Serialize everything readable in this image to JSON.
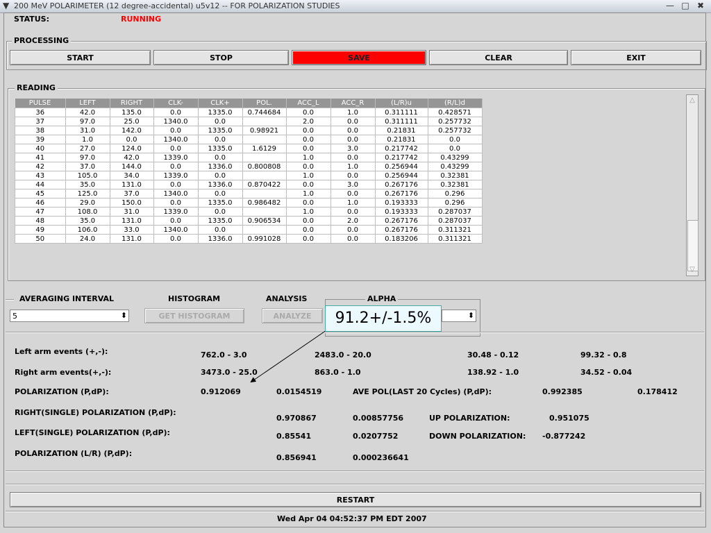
{
  "window": {
    "title": "200 MeV POLARIMETER (12 degree-accidental) u5v12 -- FOR POLARIZATION STUDIES"
  },
  "status": {
    "label": "STATUS:",
    "value": "RUNNING",
    "value_color": "#ff0000"
  },
  "processing": {
    "title": "PROCESSING",
    "buttons": [
      "START",
      "STOP",
      "SAVE",
      "CLEAR",
      "EXIT"
    ]
  },
  "reading": {
    "title": "READING",
    "headers": [
      "PULSE",
      "LEFT",
      "RIGHT",
      "CLK-",
      "CLK+",
      "POL.",
      "ACC_L",
      "ACC_R",
      "(L/R)u",
      "(R/L)d"
    ],
    "rows": [
      [
        "36",
        "42.0",
        "135.0",
        "0.0",
        "1335.0",
        "0.744684",
        "0.0",
        "1.0",
        "0.311111",
        "0.428571"
      ],
      [
        "37",
        "97.0",
        "25.0",
        "1340.0",
        "0.0",
        "",
        "2.0",
        "0.0",
        "0.311111",
        "0.257732"
      ],
      [
        "38",
        "31.0",
        "142.0",
        "0.0",
        "1335.0",
        "0.98921",
        "0.0",
        "0.0",
        "0.21831",
        "0.257732"
      ],
      [
        "39",
        "1.0",
        "0.0",
        "1340.0",
        "0.0",
        "",
        "0.0",
        "0.0",
        "0.21831",
        "0.0"
      ],
      [
        "40",
        "27.0",
        "124.0",
        "0.0",
        "1335.0",
        "1.6129",
        "0.0",
        "3.0",
        "0.217742",
        "0.0"
      ],
      [
        "41",
        "97.0",
        "42.0",
        "1339.0",
        "0.0",
        "",
        "1.0",
        "0.0",
        "0.217742",
        "0.43299"
      ],
      [
        "42",
        "37.0",
        "144.0",
        "0.0",
        "1336.0",
        "0.800808",
        "0.0",
        "1.0",
        "0.256944",
        "0.43299"
      ],
      [
        "43",
        "105.0",
        "34.0",
        "1339.0",
        "0.0",
        "",
        "1.0",
        "0.0",
        "0.256944",
        "0.32381"
      ],
      [
        "44",
        "35.0",
        "131.0",
        "0.0",
        "1336.0",
        "0.870422",
        "0.0",
        "3.0",
        "0.267176",
        "0.32381"
      ],
      [
        "45",
        "125.0",
        "37.0",
        "1340.0",
        "0.0",
        "",
        "1.0",
        "0.0",
        "0.267176",
        "0.296"
      ],
      [
        "46",
        "29.0",
        "150.0",
        "0.0",
        "1335.0",
        "0.986482",
        "0.0",
        "1.0",
        "0.193333",
        "0.296"
      ],
      [
        "47",
        "108.0",
        "31.0",
        "1339.0",
        "0.0",
        "",
        "1.0",
        "0.0",
        "0.193333",
        "0.287037"
      ],
      [
        "48",
        "35.0",
        "131.0",
        "0.0",
        "1335.0",
        "0.906534",
        "0.0",
        "2.0",
        "0.267176",
        "0.287037"
      ],
      [
        "49",
        "106.0",
        "33.0",
        "1340.0",
        "0.0",
        "",
        "0.0",
        "0.0",
        "0.267176",
        "0.311321"
      ],
      [
        "50",
        "24.0",
        "131.0",
        "0.0",
        "1336.0",
        "0.991028",
        "0.0",
        "0.0",
        "0.183206",
        "0.311321"
      ]
    ]
  },
  "controls": {
    "averaging_label": "AVERAGING INTERVAL",
    "averaging_value": "5",
    "histogram_label": "HISTOGRAM",
    "histogram_button": "GET HISTOGRAM",
    "analysis_label": "ANALYSIS",
    "analysis_button": "ANALYZE",
    "alpha_label": "ALPHA"
  },
  "callout": {
    "text": "91.2+/-1.5%"
  },
  "results": {
    "left_arm": {
      "label": "Left arm events (+,-):",
      "v1": "762.0 - 3.0",
      "v2": "2483.0 - 20.0",
      "v3": "30.48 - 0.12",
      "v4": "99.32 - 0.8"
    },
    "right_arm": {
      "label": "Right arm events(+,-):",
      "v1": "3473.0 - 25.0",
      "v2": "863.0 - 1.0",
      "v3": "138.92 - 1.0",
      "v4": "34.52 - 0.04"
    },
    "polarization": {
      "label": "POLARIZATION (P,dP):",
      "p": "0.912069",
      "dp": "0.0154519",
      "ave_label": "AVE POL(LAST 20 Cycles) (P,dP):",
      "ave_p": "0.992385",
      "ave_dp": "0.178412"
    },
    "right_single": {
      "label": "RIGHT(SINGLE) POLARIZATION (P,dP):",
      "p": "0.970867",
      "dp": "0.00857756",
      "up_label": "UP POLARIZATION:",
      "up": "0.951075"
    },
    "left_single": {
      "label": "LEFT(SINGLE) POLARIZATION (P,dP):",
      "p": "0.85541",
      "dp": "0.0207752",
      "down_label": "DOWN POLARIZATION:",
      "down": "-0.877242"
    },
    "polarization_lr": {
      "label": "POLARIZATION (L/R) (P,dP):",
      "p": "0.856941",
      "dp": "0.000236641"
    }
  },
  "restart": {
    "label": "RESTART"
  },
  "timestamp": "Wed Apr 04 04:52:37 PM EDT 2007"
}
